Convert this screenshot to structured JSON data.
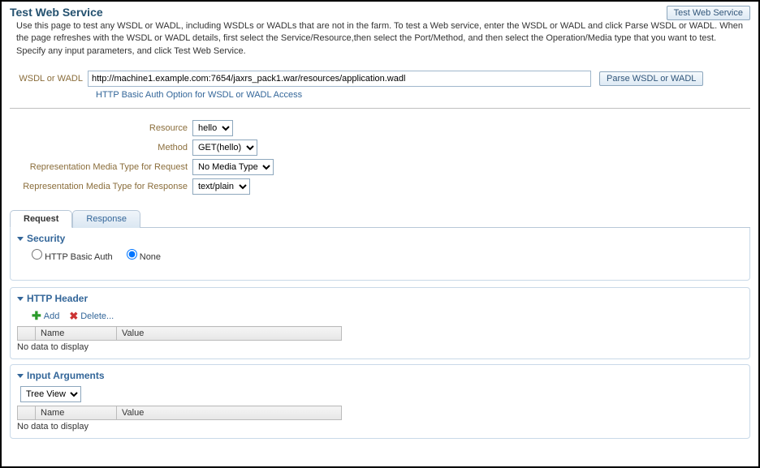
{
  "header": {
    "title": "Test Web Service",
    "button": "Test Web Service",
    "description": "Use this page to test any WSDL or WADL, including WSDLs or WADLs that are not in the farm. To test a Web service, enter the WSDL or WADL and click Parse WSDL or WADL. When the page refreshes with the WSDL or WADL details, first select the Service/Resource,then select the Port/Method, and then select the Operation/Media type that you want to test. Specify any input parameters, and click Test Web Service."
  },
  "wsdl": {
    "label": "WSDL or WADL",
    "value": "http://machine1.example.com:7654/jaxrs_pack1.war/resources/application.wadl",
    "parse_button": "Parse WSDL or WADL",
    "auth_link": "HTTP Basic Auth Option for WSDL or WADL Access"
  },
  "selectors": {
    "resource_label": "Resource",
    "resource_value": "hello",
    "method_label": "Method",
    "method_value": "GET(hello)",
    "request_media_label": "Representation Media Type for Request",
    "request_media_value": "No Media Type",
    "response_media_label": "Representation Media Type for Response",
    "response_media_value": "text/plain"
  },
  "tabs": {
    "request": "Request",
    "response": "Response"
  },
  "security": {
    "title": "Security",
    "http_basic": "HTTP Basic Auth",
    "none": "None"
  },
  "http_header": {
    "title": "HTTP Header",
    "add": "Add",
    "delete": "Delete...",
    "col_name": "Name",
    "col_value": "Value",
    "no_data": "No data to display"
  },
  "input_args": {
    "title": "Input Arguments",
    "tree_view": "Tree View",
    "col_name": "Name",
    "col_value": "Value",
    "no_data": "No data to display"
  }
}
